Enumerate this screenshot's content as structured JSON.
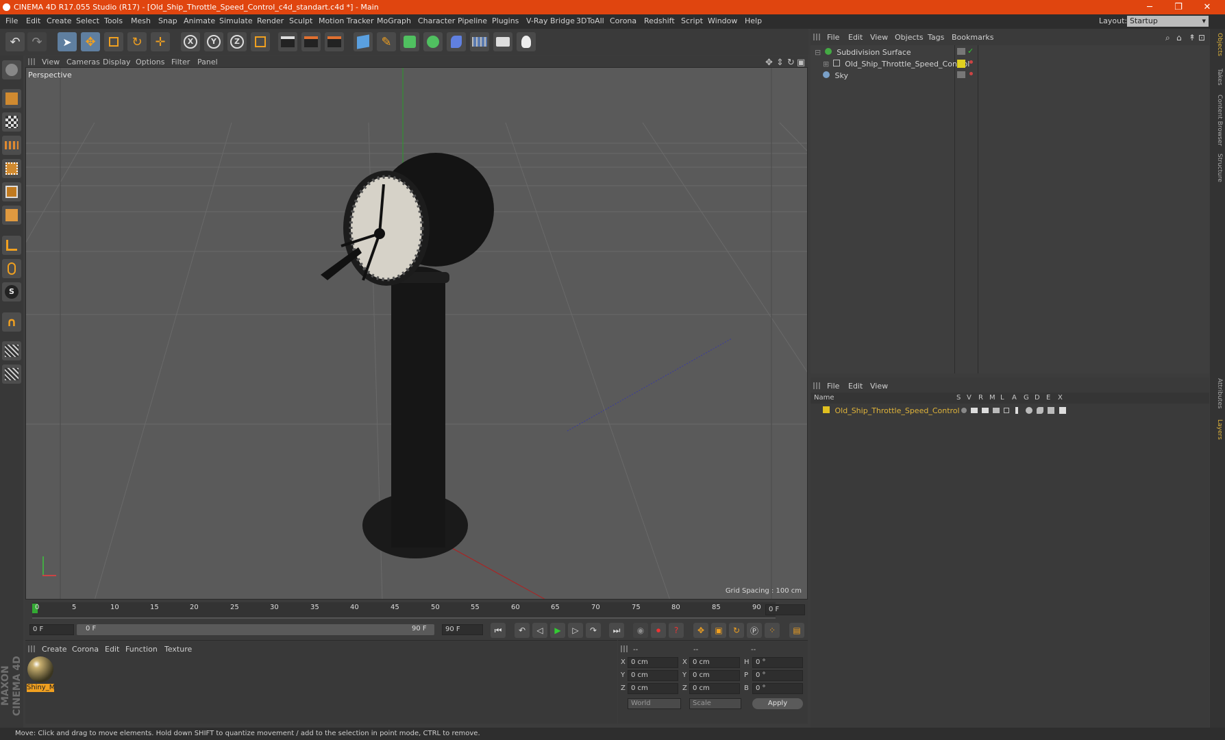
{
  "window": {
    "title": "CINEMA 4D R17.055 Studio (R17) - [Old_Ship_Throttle_Speed_Control_c4d_standart.c4d *] - Main",
    "min": "─",
    "max": "❐",
    "close": "✕"
  },
  "menu": [
    "File",
    "Edit",
    "Create",
    "Select",
    "Tools",
    "Mesh",
    "Snap",
    "Animate",
    "Simulate",
    "Render",
    "Sculpt",
    "Motion Tracker",
    "MoGraph",
    "Character",
    "Pipeline",
    "Plugins",
    "V-Ray Bridge",
    "3DToAll",
    "Corona",
    "Redshift",
    "Script",
    "Window",
    "Help"
  ],
  "layout": {
    "label": "Layout:",
    "value": "Startup"
  },
  "viewport": {
    "menu": [
      "View",
      "Cameras",
      "Display",
      "Options",
      "Filter",
      "Panel"
    ],
    "camera": "Perspective",
    "grid_spacing": "Grid Spacing : 100 cm"
  },
  "timeline": {
    "ticks": [
      "0",
      "5",
      "10",
      "15",
      "20",
      "25",
      "30",
      "35",
      "40",
      "45",
      "50",
      "55",
      "60",
      "65",
      "70",
      "75",
      "80",
      "85",
      "90"
    ],
    "current": "0 F",
    "start": "0 F",
    "range_start": "0 F",
    "range_end": "90 F",
    "end": "90 F"
  },
  "materials": {
    "menu": [
      "Create",
      "Corona",
      "Edit",
      "Function",
      "Texture"
    ],
    "items": [
      {
        "name": "Shiny_M"
      }
    ]
  },
  "coords": {
    "headers": [
      "--",
      "--",
      "--"
    ],
    "rows": [
      {
        "a": "X",
        "av": "0 cm",
        "b": "X",
        "bv": "0 cm",
        "c": "H",
        "cv": "0 °"
      },
      {
        "a": "Y",
        "av": "0 cm",
        "b": "Y",
        "bv": "0 cm",
        "c": "P",
        "cv": "0 °"
      },
      {
        "a": "Z",
        "av": "0 cm",
        "b": "Z",
        "bv": "0 cm",
        "c": "B",
        "cv": "0 °"
      }
    ],
    "world": "World",
    "scale": "Scale",
    "apply": "Apply"
  },
  "objects": {
    "menu": [
      "File",
      "Edit",
      "View",
      "Objects",
      "Tags",
      "Bookmarks"
    ],
    "items": [
      "Subdivision Surface",
      "Old_Ship_Throttle_Speed_Control",
      "Sky"
    ]
  },
  "layers": {
    "menu": [
      "File",
      "Edit",
      "View"
    ],
    "name_header": "Name",
    "flags": [
      "S",
      "V",
      "R",
      "M",
      "L",
      "A",
      "G",
      "D",
      "E",
      "X"
    ],
    "item": "Old_Ship_Throttle_Speed_Control"
  },
  "right_tabs": [
    "Objects",
    "Takes",
    "Content Browser",
    "Structure",
    "Attributes",
    "Layers"
  ],
  "brand": "MAXON CINEMA 4D",
  "status": "Move: Click and drag to move elements. Hold down SHIFT to quantize movement / add to the selection in point mode, CTRL to remove.",
  "colors": {
    "accent": "#e0450f",
    "layer": "#e0b43a"
  }
}
